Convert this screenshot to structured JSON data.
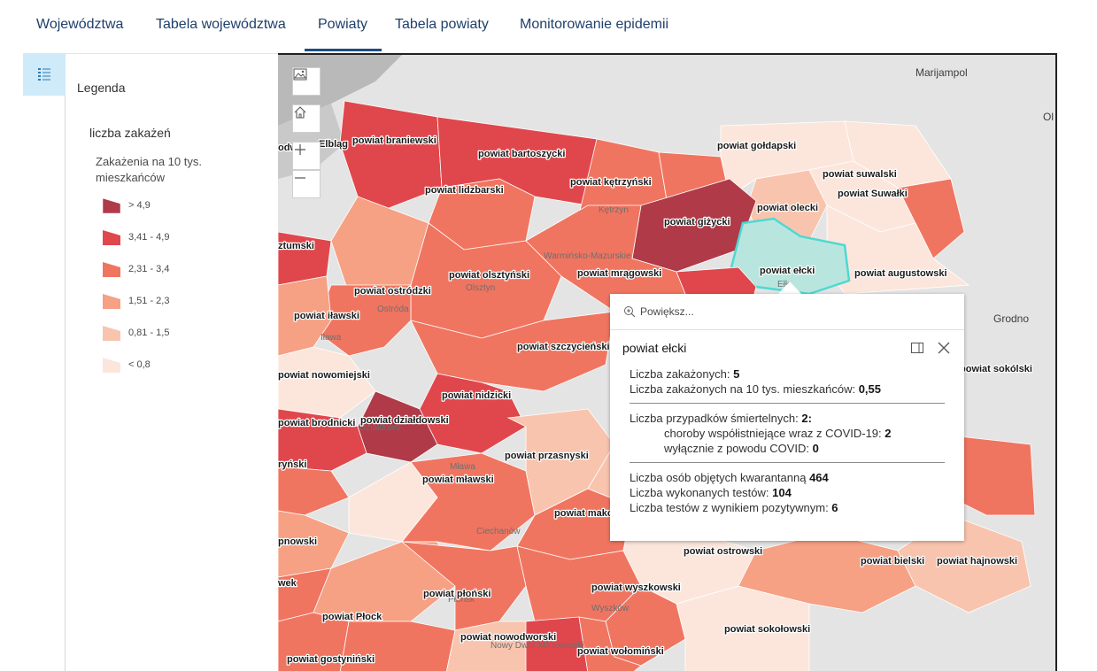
{
  "tabs": [
    {
      "label": "Województwa"
    },
    {
      "label": "Tabela województwa"
    },
    {
      "label": "Powiaty"
    },
    {
      "label": "Tabela powiaty"
    },
    {
      "label": "Monitorowanie epidemii"
    }
  ],
  "active_tab": "Powiaty",
  "legend": {
    "title": "Legenda",
    "layer": "liczba zakażeń",
    "field": "Zakażenia na 10 tys. mieszkańców",
    "classes": [
      {
        "label": "> 4,9",
        "color": "#b03a48"
      },
      {
        "label": "3,41 - 4,9",
        "color": "#e0474c"
      },
      {
        "label": "2,31 - 3,4",
        "color": "#f07560"
      },
      {
        "label": "1,51 - 2,3",
        "color": "#f6a084"
      },
      {
        "label": "0,81 - 1,5",
        "color": "#f9c4ae"
      },
      {
        "label": "< 0,8",
        "color": "#fce6dc"
      }
    ]
  },
  "map": {
    "controls": [
      "basemap-gallery-icon",
      "home-icon",
      "zoom-in-icon",
      "zoom-out-icon"
    ],
    "cities": [
      "Marijampol",
      "Grodno"
    ],
    "background_labels": [
      "Kętrzyn",
      "Ostróda",
      "Iława",
      "Działdowo",
      "Mława",
      "Ciechanów",
      "Wyszków",
      "Płońsk",
      "Nowy Dwór Mazowiecki",
      "Ełk",
      "Olsztyn",
      "Warmińsko-Mazurskie"
    ],
    "powiats": [
      "powiat braniewski",
      "powiat bartoszycki",
      "powiat gołdapski",
      "powiat suwalski",
      "powiat Suwałki",
      "powiat lidzbarski",
      "powiat kętrzyński",
      "powiat giżycki",
      "powiat olecki",
      "powiat ełcki",
      "powiat augustowski",
      "powiat olsztyński",
      "powiat mrągowski",
      "powiat ostródzki",
      "powiat iławski",
      "powiat szczycieński",
      "powiat nowomiejski",
      "powiat nidzicki",
      "powiat działdowski",
      "powiat brodnicki",
      "powiat przasnyski",
      "powiat mławski",
      "powiat ostrowski",
      "powiat bielski",
      "powiat hajnowski",
      "powiat płoński",
      "powiat wyszkowski",
      "powiat Płock",
      "powiat sokołowski",
      "powiat nowodworski",
      "powiat wołomiński",
      "powiat gostyniński",
      "Elbląg",
      "powiat makowski",
      "powiat sokólski"
    ],
    "partial_labels": [
      "odw",
      "Elbląg",
      "ztumski",
      "ryński",
      "pnowski",
      "wek",
      "kólski",
      "Ol"
    ]
  },
  "popup": {
    "zoom_label": "Powiększ...",
    "title": "powiat ełcki",
    "rows": [
      {
        "label": "Liczba zakażonych: ",
        "value": "5"
      },
      {
        "label": "Liczba zakażonych na 10 tys. mieszkańców: ",
        "value": "0,55"
      },
      {
        "label": "Liczba przypadków śmiertelnych: ",
        "value": "2:"
      },
      {
        "label": "choroby współistniejące wraz z COVID-19: ",
        "value": "2"
      },
      {
        "label": "wyłącznie z powodu COVID: ",
        "value": "0"
      },
      {
        "label": "Liczba osób objętych kwarantanną ",
        "value": "464"
      },
      {
        "label": "Liczba wykonanych testów: ",
        "value": "104"
      },
      {
        "label": "Liczba testów z wynikiem pozytywnym: ",
        "value": "6"
      }
    ]
  }
}
